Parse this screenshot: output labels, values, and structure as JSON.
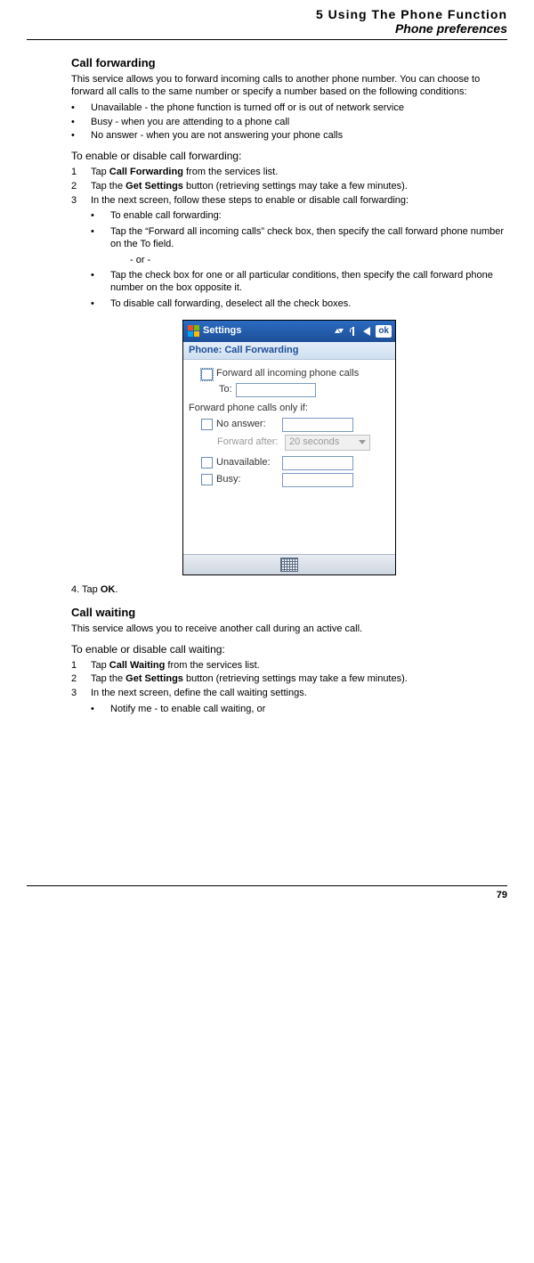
{
  "header": {
    "chapter": "5 Using The Phone Function",
    "subtitle": "Phone preferences"
  },
  "call_forwarding": {
    "heading": "Call forwarding",
    "intro": "This service allows you to forward incoming calls to another phone number. You can choose to forward all calls to the same number or specify a number based on the following conditions:",
    "conditions": {
      "unavailable": "Unavailable - the phone function is turned off or is out of network service",
      "busy": "Busy - when you are attending to a phone call",
      "noanswer": "No answer - when you are not answering your phone calls"
    },
    "enable_title": "To enable or disable call forwarding:",
    "steps": {
      "s1_pre": "Tap ",
      "s1_bold": "Call Forwarding",
      "s1_post": " from the services list.",
      "s2_pre": "Tap the ",
      "s2_bold": "Get Settings",
      "s2_post": " button (retrieving settings may take a few minutes).",
      "s3": "In the next screen, follow these steps to enable or disable call forwarding:",
      "s3_enable": "To enable call forwarding:",
      "s3_enable_a": "Tap the “Forward all incoming calls” check box, then specify the call forward phone number on the To field.",
      "s3_or": "- or -",
      "s3_enable_b": "Tap the check box for one or all particular conditions, then specify the call forward phone number on the box opposite it.",
      "s3_disable": "To disable call forwarding, deselect all the check boxes."
    },
    "step4_pre": "4. Tap ",
    "step4_bold": "OK",
    "step4_post": "."
  },
  "device": {
    "title": "Settings",
    "ok": "ok",
    "subtitle": "Phone: Call Forwarding",
    "forward_all": "Forward all incoming phone calls",
    "to_label": "To:",
    "only_if": "Forward phone calls only if:",
    "no_answer": "No answer:",
    "forward_after": "Forward after:",
    "forward_after_value": "20 seconds",
    "unavailable": "Unavailable:",
    "busy": "Busy:"
  },
  "call_waiting": {
    "heading": "Call waiting",
    "intro": "This service allows you to receive another call during an active call.",
    "enable_title": "To enable or disable call waiting:",
    "steps": {
      "s1_pre": "Tap ",
      "s1_bold": "Call Waiting",
      "s1_post": " from the services list.",
      "s2_pre": "Tap the ",
      "s2_bold": "Get Settings",
      "s2_post": " button (retrieving settings may take a few minutes).",
      "s3": "In the next screen, define the call waiting settings.",
      "s3_a": "Notify me - to enable call waiting, or"
    }
  },
  "page_number": "79"
}
